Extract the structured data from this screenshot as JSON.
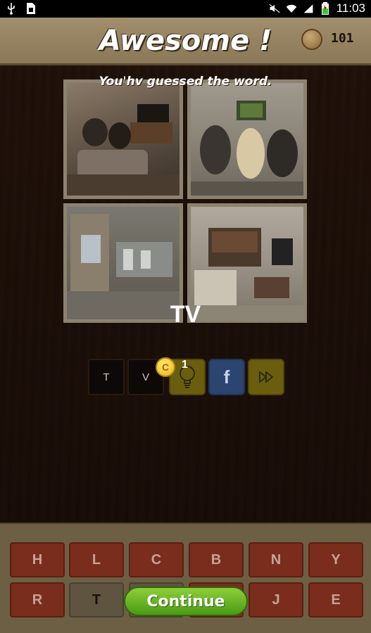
{
  "status_bar": {
    "time": "11:03"
  },
  "header": {
    "title": "Awesome !",
    "coins": "101"
  },
  "result": {
    "subtitle": "You'hv guessed the word.",
    "answer": "TV"
  },
  "answer_slots": [
    "T",
    "V"
  ],
  "hint": {
    "coin_symbol": "C",
    "cost": "1"
  },
  "tools": {
    "facebook": "f"
  },
  "keyboard": {
    "row1": [
      "H",
      "L",
      "C",
      "B",
      "N",
      "Y"
    ],
    "row2": [
      "R",
      "T",
      "",
      "",
      "J",
      "E"
    ]
  },
  "continue_label": "Continue",
  "icons": [
    "usb-icon",
    "sim-icon",
    "mute-icon",
    "wifi-icon",
    "signal-icon",
    "battery-icon",
    "lightbulb-icon",
    "facebook-icon",
    "fast-forward-icon",
    "coin-icon"
  ]
}
